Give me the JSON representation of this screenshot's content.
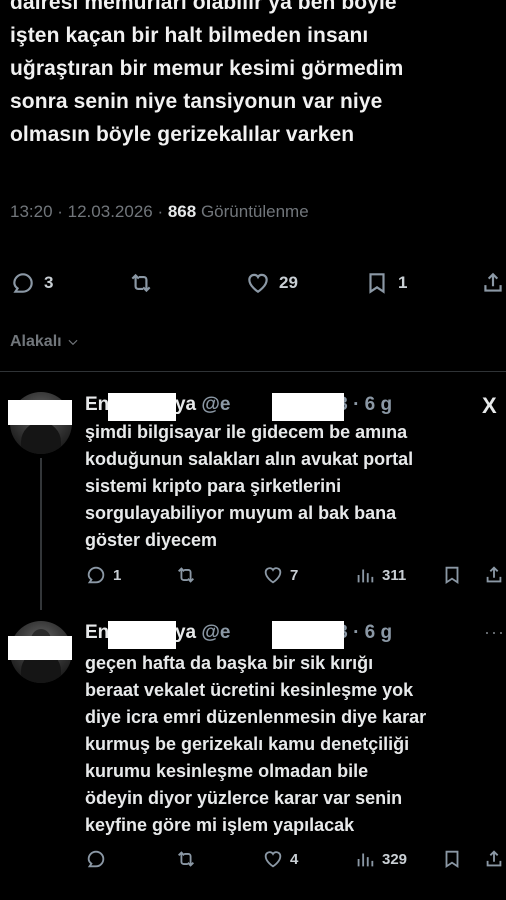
{
  "tweet": {
    "lines": [
      "dairesi memurları olabilir ya ben böyle",
      "işten kaçan bir halt bilmeden insanı",
      "uğraştıran bir memur kesimi görmedim",
      "sonra senin niye tansiyonun var niye",
      "olmasın böyle gerizekalılar varken"
    ],
    "time": "13:20 · 12.03.2026 · ",
    "views": "868",
    "views_label": " Görüntülenme",
    "replies": "3",
    "likes": "29",
    "bookmarks": "1"
  },
  "sort_label": "Alakalı",
  "replies": [
    {
      "name_start": "En",
      "name_end": "akaya",
      "handle_start": "@e",
      "handle_end": "ky23",
      "age": "· 6 g",
      "lines": [
        "şimdi bilgisayar ile gidecem be amına",
        "koduğunun salakları alın avukat portal",
        "sistemi kripto para şirketlerini",
        "sorgulayabiliyor muyum al bak bana",
        "göster diyecem"
      ],
      "replies": "1",
      "likes": "7",
      "views": "311"
    },
    {
      "name_start": "En",
      "name_end": "akaya",
      "handle_start": "@e",
      "handle_end": "ky23",
      "age": "· 6 g",
      "lines": [
        "geçen hafta da başka bir sik kırığı",
        "beraat vekalet ücretini kesinleşme yok",
        "diye icra emri düzenlenmesin diye karar",
        "kurmuş be gerizekalı kamu denetçiliği",
        "kurumu kesinleşme olmadan bile",
        "ödeyin diyor yüzlerce karar var senin",
        "keyfine göre mi işlem yapılacak"
      ],
      "replies": "",
      "likes": "4",
      "views": "329"
    }
  ],
  "logo_text": "X",
  "more_text": "···",
  "colors": {
    "background": "#000000",
    "text": "#e7e9ea",
    "muted": "#71767b",
    "divider": "#2f3336"
  }
}
